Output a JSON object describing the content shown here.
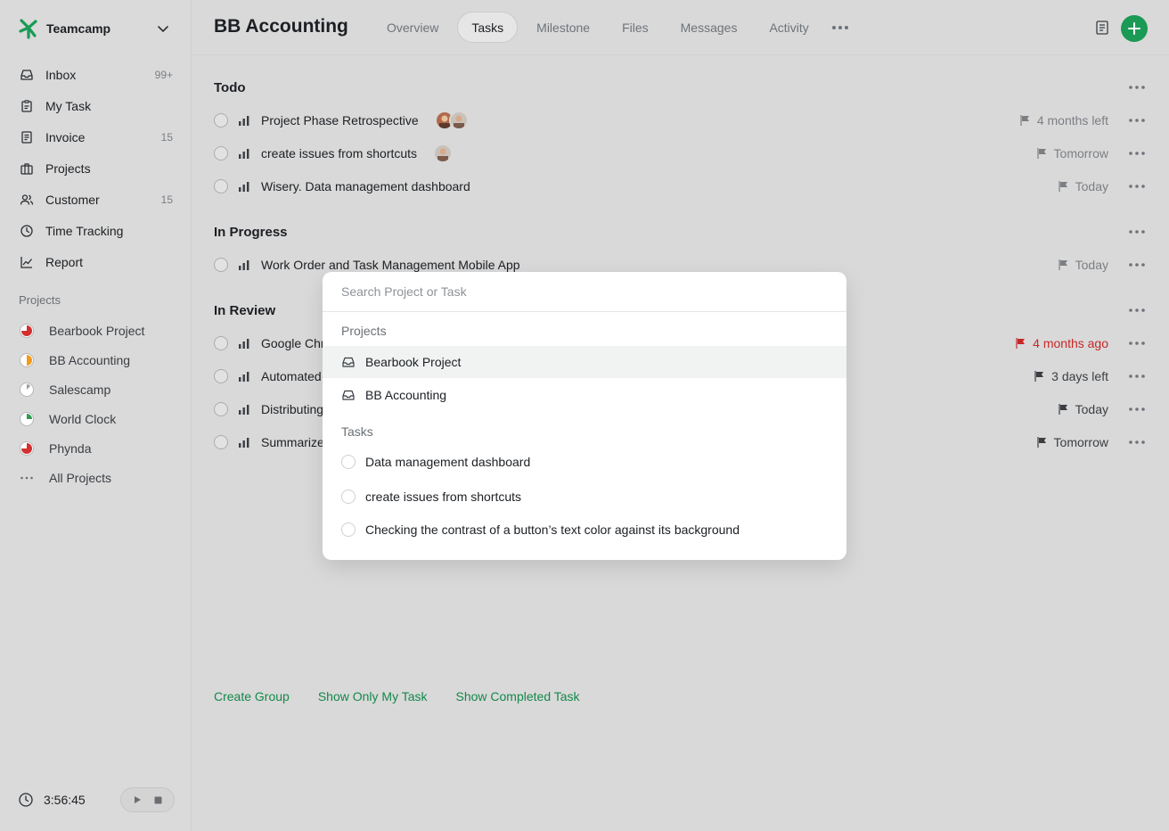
{
  "app": {
    "name": "Teamcamp"
  },
  "sidebar": {
    "items": [
      {
        "label": "Inbox",
        "count": "99+",
        "icon": "inbox-icon"
      },
      {
        "label": "My Task",
        "count": "",
        "icon": "clipboard-icon"
      },
      {
        "label": "Invoice",
        "count": "15",
        "icon": "invoice-icon"
      },
      {
        "label": "Projects",
        "count": "",
        "icon": "briefcase-icon"
      },
      {
        "label": "Customer",
        "count": "15",
        "icon": "users-icon"
      },
      {
        "label": "Time Tracking",
        "count": "",
        "icon": "clock-icon"
      },
      {
        "label": "Report",
        "count": "",
        "icon": "chart-line-icon"
      }
    ],
    "projects_title": "Projects",
    "projects": [
      {
        "label": "Bearbook Project",
        "color": "#d32f2f",
        "progress": 0.75
      },
      {
        "label": "BB Accounting",
        "color": "#f29a1a",
        "progress": 0.5
      },
      {
        "label": "Salescamp",
        "color": "#9e9e9e",
        "progress": 0.12
      },
      {
        "label": "World Clock",
        "color": "#2e9b4f",
        "progress": 0.25
      },
      {
        "label": "Phynda",
        "color": "#d32f2f",
        "progress": 0.75
      }
    ],
    "all_projects": "All Projects",
    "timer": "3:56:45"
  },
  "header": {
    "title": "BB Accounting",
    "tabs": [
      "Overview",
      "Tasks",
      "Milestone",
      "Files",
      "Messages",
      "Activity"
    ],
    "active_tab": "Tasks"
  },
  "groups": {
    "todo": {
      "title": "Todo",
      "tasks": [
        {
          "name": "Project Phase Retrospective",
          "due": "4 months left"
        },
        {
          "name": "create issues from shortcuts",
          "due": "Tomorrow"
        },
        {
          "name": "Wisery. Data management dashboard",
          "due": "Today"
        }
      ]
    },
    "in_progress": {
      "title": "In Progress",
      "tasks": [
        {
          "name": "Work Order and Task Management Mobile App",
          "due": "Today"
        }
      ]
    },
    "in_review": {
      "title": "In Review",
      "tasks": [
        {
          "name": "Google Chr",
          "due": "4 months ago",
          "overdue": true
        },
        {
          "name": "Automated",
          "due": "3 days left"
        },
        {
          "name": "Distributing",
          "due": "Today"
        },
        {
          "name": "Summarize",
          "due": "Tomorrow"
        }
      ]
    }
  },
  "footer": {
    "create_group": "Create Group",
    "show_my_task": "Show Only My Task",
    "show_completed": "Show Completed Task"
  },
  "popup": {
    "search_placeholder": "Search Project or Task",
    "projects_title": "Projects",
    "projects": [
      "Bearbook Project",
      "BB Accounting"
    ],
    "tasks_title": "Tasks",
    "tasks": [
      "Data management dashboard",
      "create issues from shortcuts",
      "Checking the contrast of a button’s text color against its background"
    ]
  },
  "colors": {
    "accent": "#1a9a55",
    "overdue": "#c62828"
  }
}
